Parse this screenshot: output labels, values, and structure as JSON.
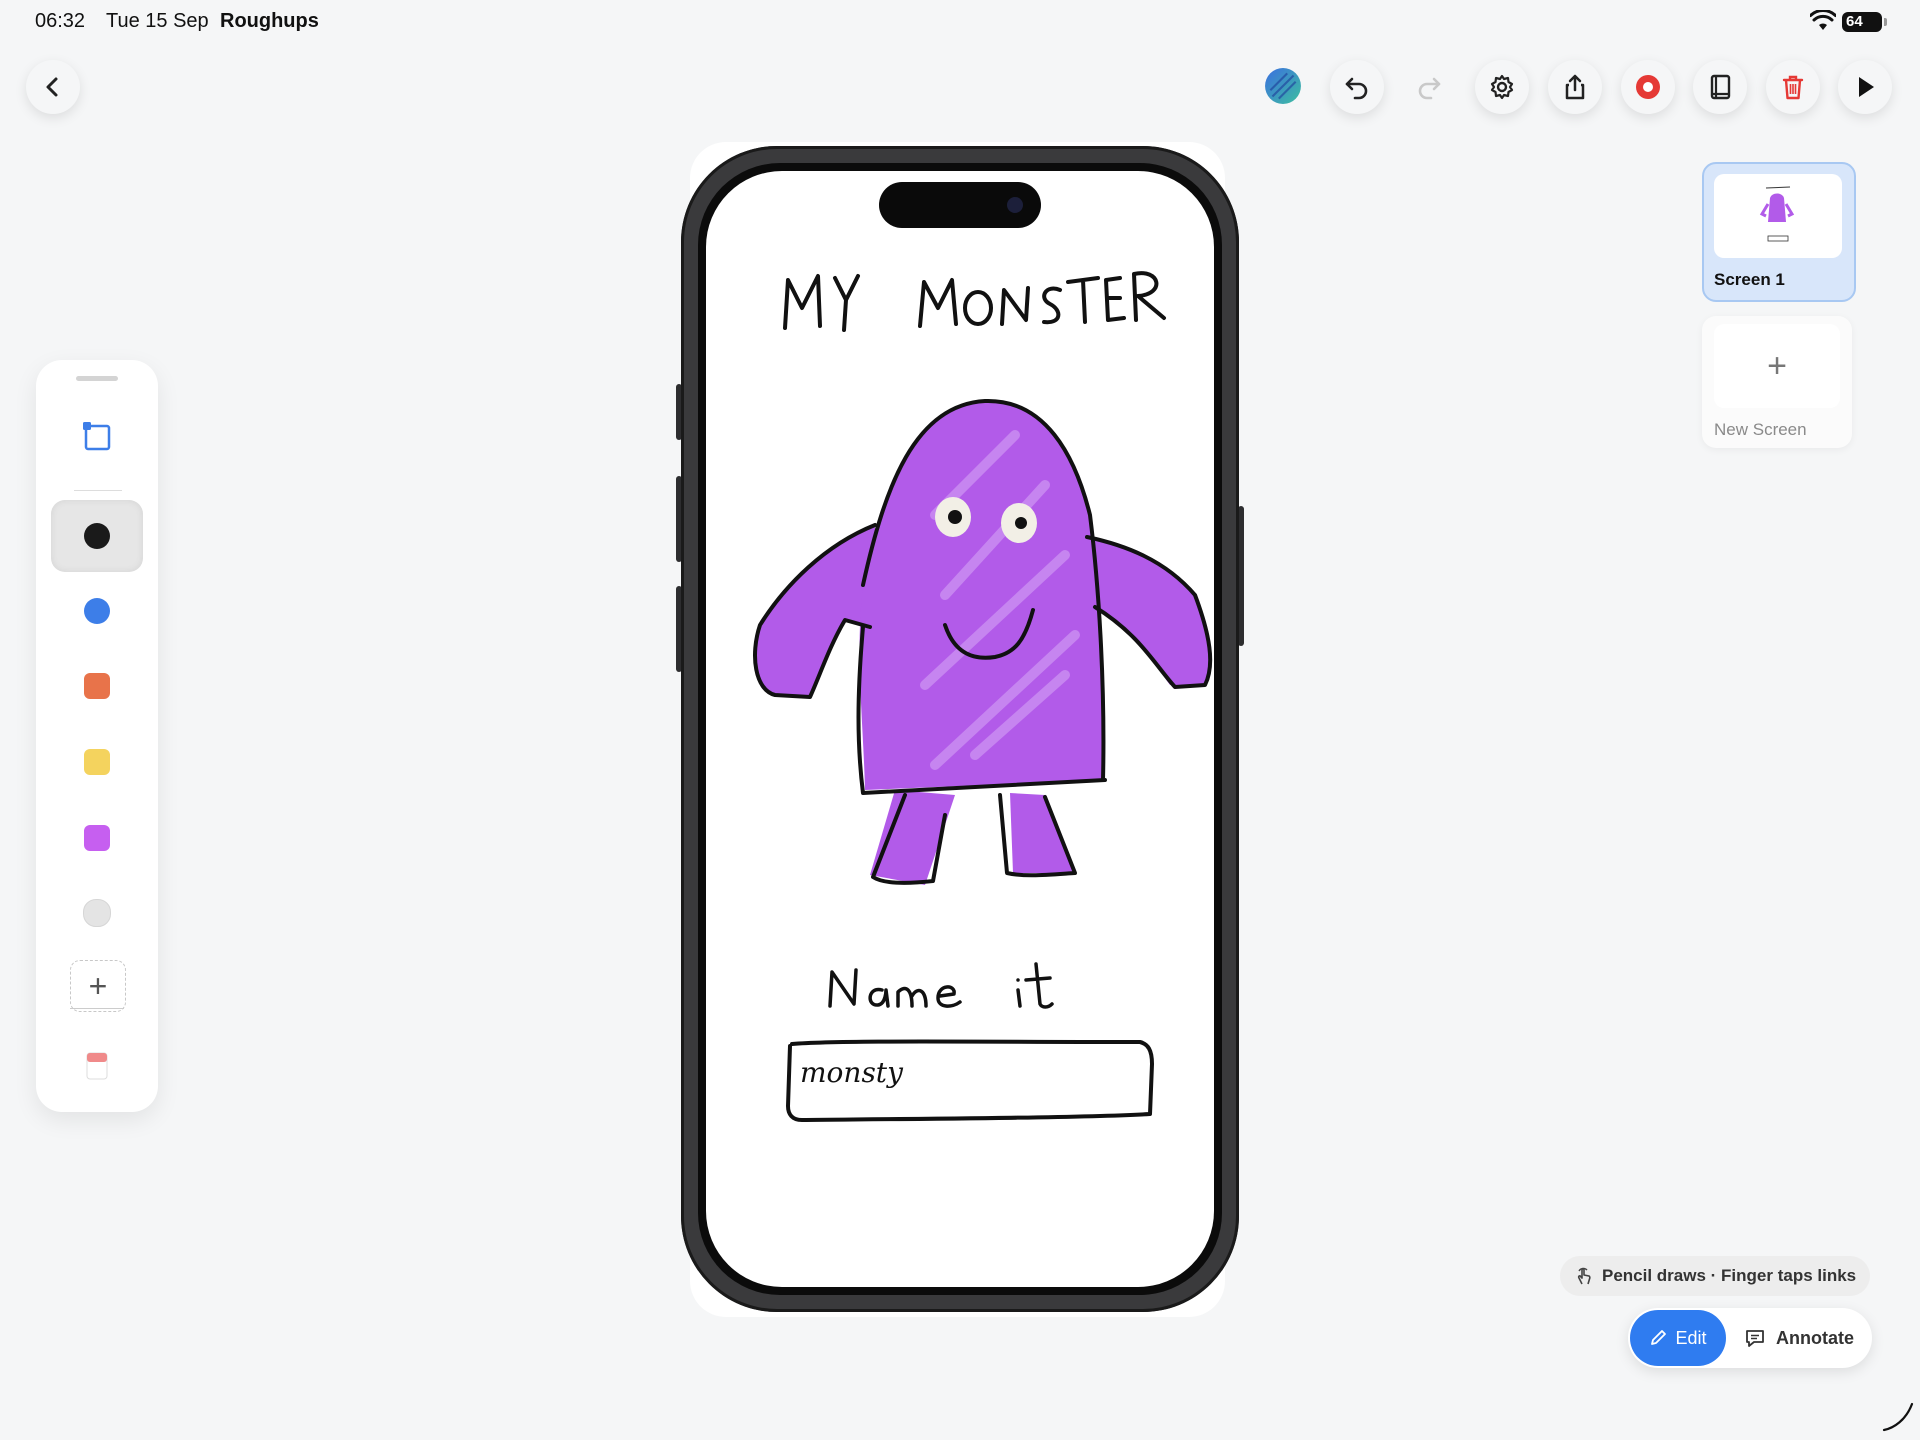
{
  "status_bar": {
    "time": "06:32",
    "date": "Tue 15 Sep",
    "app_name": "Roughups",
    "battery": "64"
  },
  "toolbar": {
    "back_icon": "chevron-left-icon",
    "avatar_icon": "scribble-avatar-icon",
    "undo_icon": "undo-icon",
    "redo_icon": "redo-icon",
    "settings_icon": "gear-icon",
    "share_icon": "share-icon",
    "record_icon": "record-icon",
    "book_icon": "book-icon",
    "trash_icon": "trash-icon",
    "play_icon": "play-icon",
    "record_color": "#e53935",
    "trash_color": "#e53935"
  },
  "palette": {
    "tool_icon": "crop-frame-icon",
    "colors": [
      "#1a1a1a",
      "#3d7ee8",
      "#e8734a",
      "#f4d35e",
      "#c65ff0",
      "#e4e4e4"
    ],
    "selected_index": 0,
    "add_label": "+",
    "eraser_icon": "eraser-icon"
  },
  "canvas": {
    "title_handwritten": "MY MONSTER",
    "prompt_handwritten": "Name it",
    "input_value": "monsty",
    "monster_color": "#b25be9"
  },
  "screens": [
    {
      "label": "Screen 1",
      "selected": true
    }
  ],
  "new_screen": {
    "plus": "+",
    "label": "New Screen"
  },
  "hint": {
    "text": "Pencil draws · Finger taps links",
    "icon": "finger-tap-icon"
  },
  "mode_switch": {
    "edit_label": "Edit",
    "annotate_label": "Annotate",
    "active": "Edit",
    "accent": "#2f7cf0"
  }
}
